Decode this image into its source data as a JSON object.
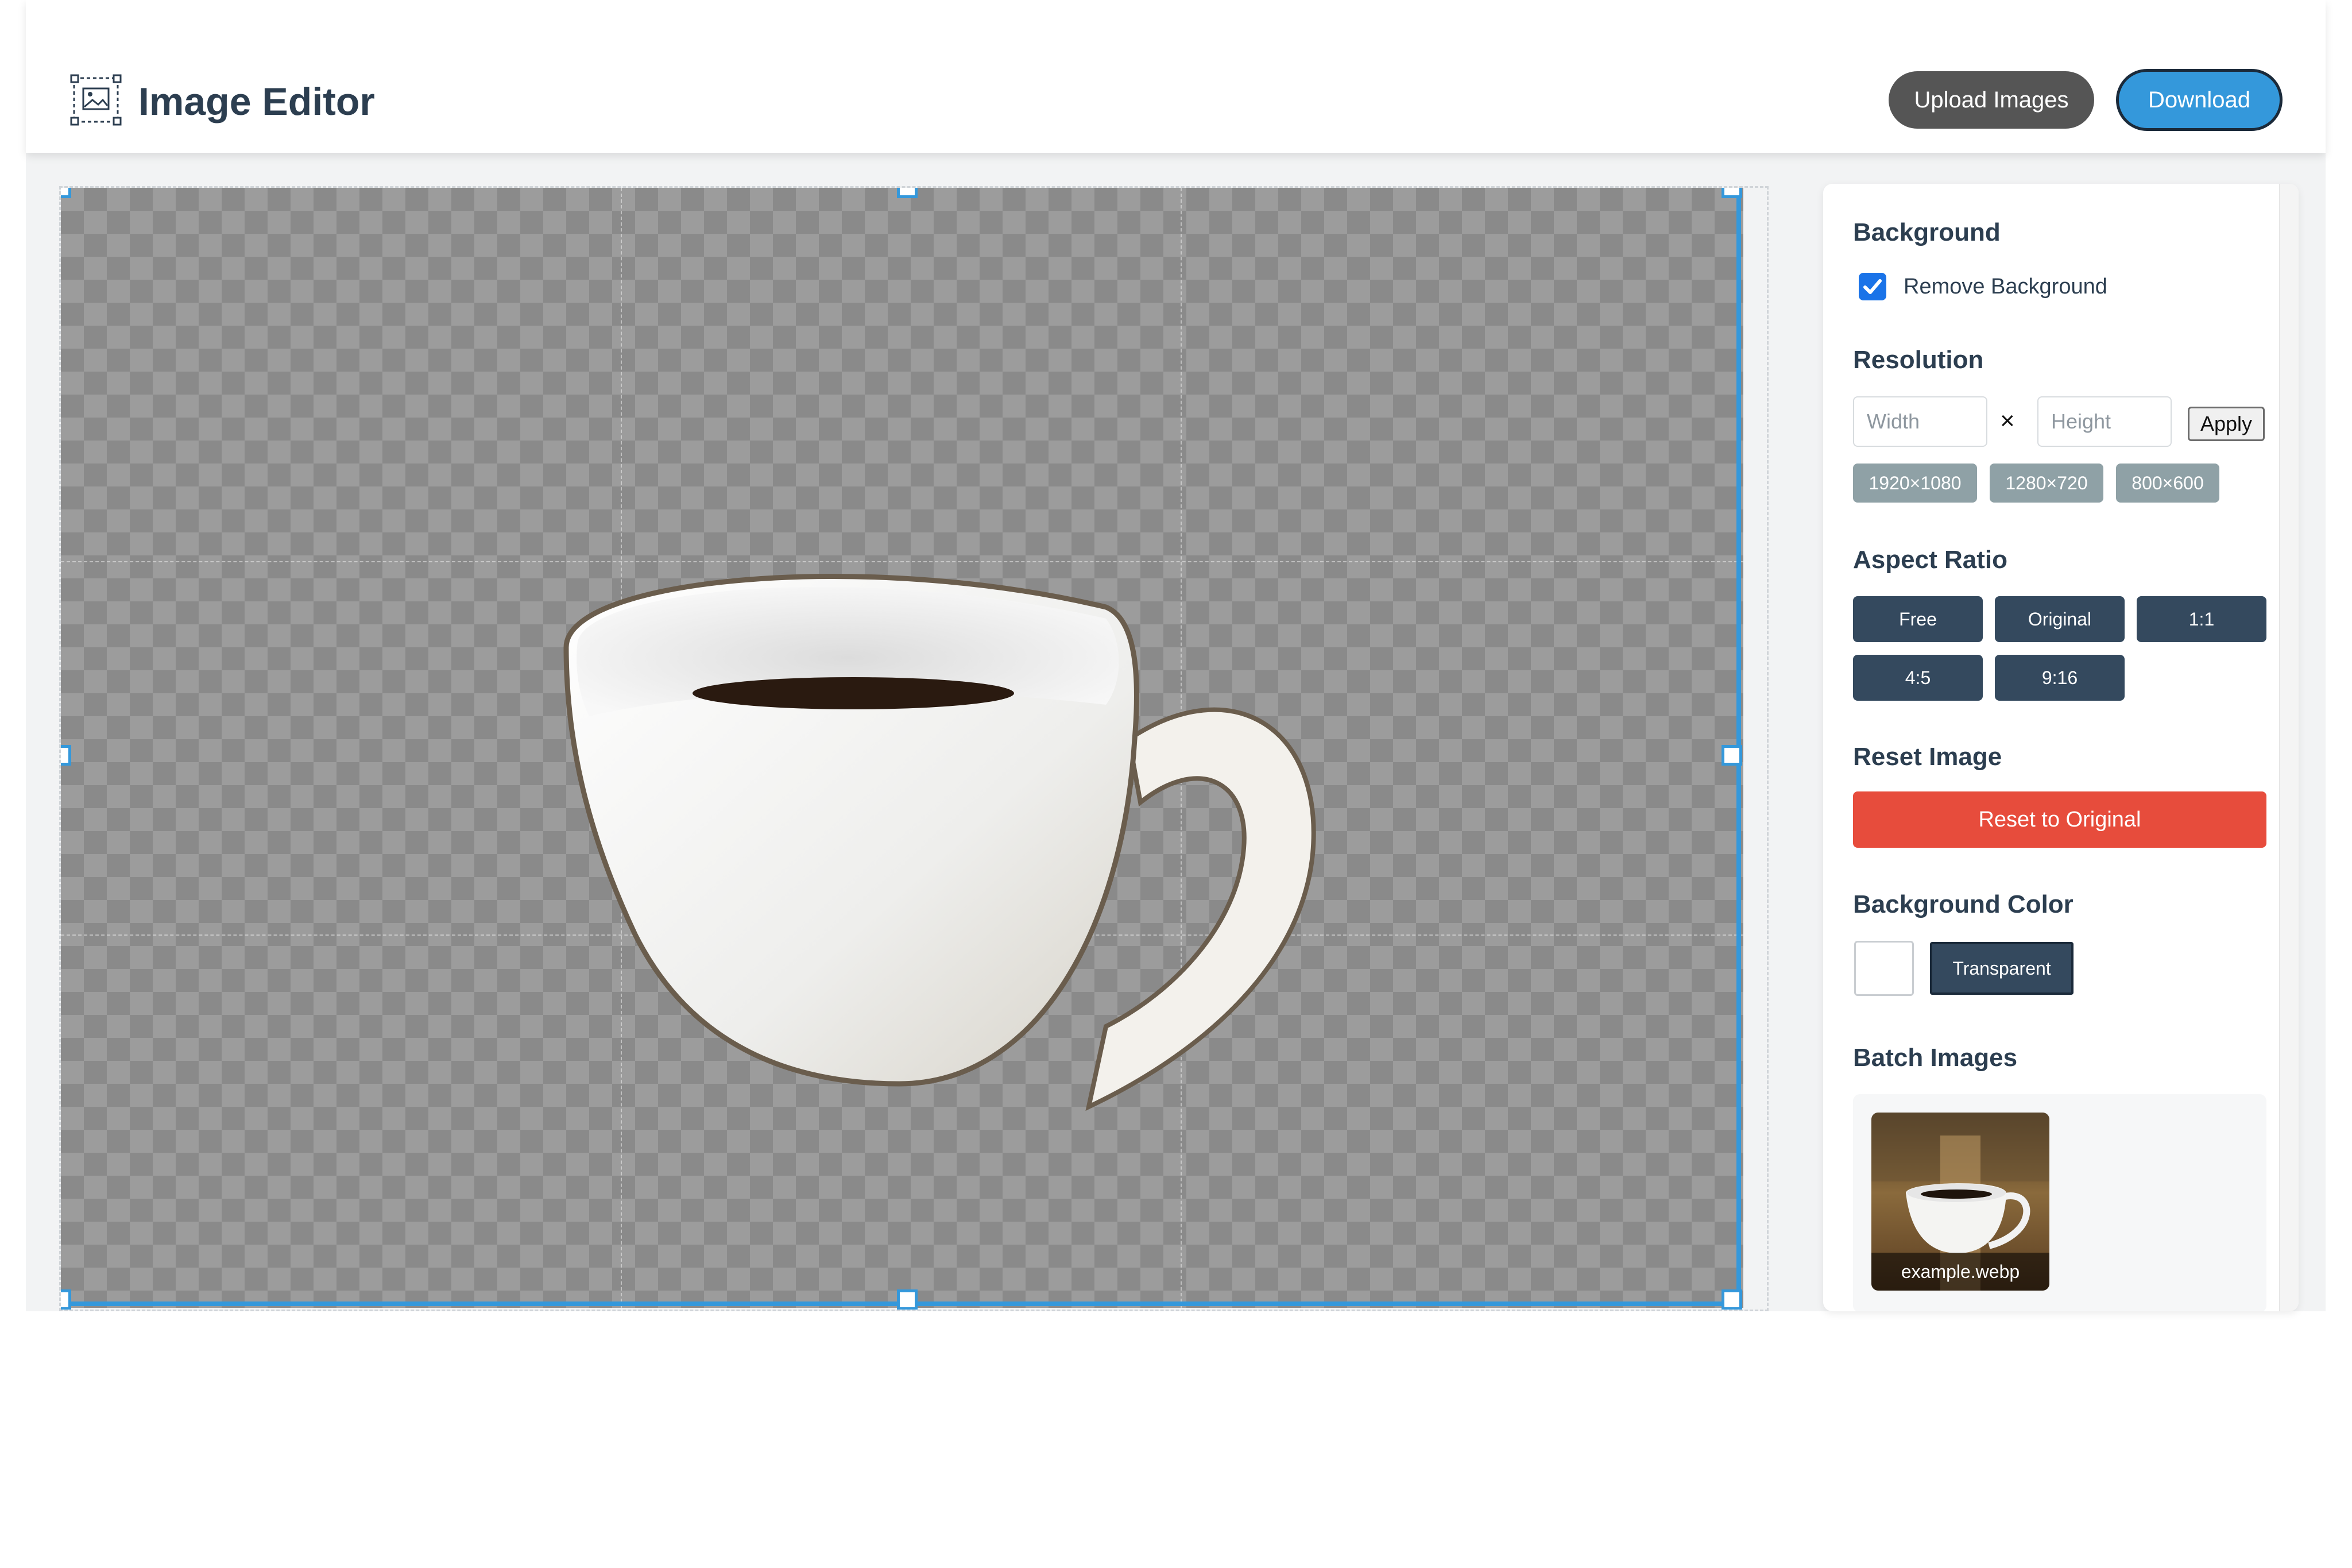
{
  "app": {
    "title": "Image Editor",
    "logo_icon": "image-select-icon"
  },
  "header": {
    "upload_label": "Upload Images",
    "download_label": "Download"
  },
  "canvas": {
    "zoom_out_label": "-",
    "zoom_in_label": "+"
  },
  "sidebar": {
    "background": {
      "title": "Background",
      "remove_background_label": "Remove Background",
      "remove_background_checked": true
    },
    "resolution": {
      "title": "Resolution",
      "width_placeholder": "Width",
      "height_placeholder": "Height",
      "separator": "×",
      "apply_label": "Apply",
      "presets": [
        "1920×1080",
        "1280×720",
        "800×600"
      ]
    },
    "aspect_ratio": {
      "title": "Aspect Ratio",
      "options": [
        "Free",
        "Original",
        "1:1",
        "4:5",
        "9:16"
      ]
    },
    "reset": {
      "title": "Reset Image",
      "button_label": "Reset to Original"
    },
    "background_color": {
      "title": "Background Color",
      "swatch_color": "#ffffff",
      "transparent_label": "Transparent"
    },
    "batch": {
      "title": "Batch Images",
      "items": [
        {
          "filename": "example.webp"
        }
      ]
    }
  },
  "colors": {
    "accent": "#3498db",
    "dark": "#34495e",
    "danger": "#e74c3c",
    "preset": "#8fa1a6"
  }
}
